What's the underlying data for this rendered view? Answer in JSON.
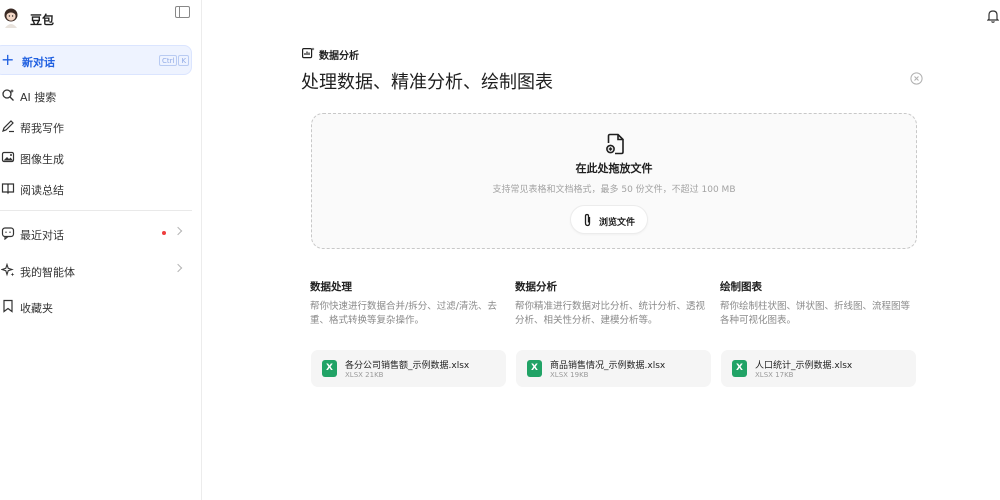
{
  "app": {
    "name": "豆包"
  },
  "sidebar": {
    "new_chat": {
      "label": "新对话",
      "shortcut": [
        "Ctrl",
        "K"
      ]
    },
    "items": [
      {
        "label": "AI 搜索",
        "icon": "ai-search-icon"
      },
      {
        "label": "帮我写作",
        "icon": "pen-icon"
      },
      {
        "label": "图像生成",
        "icon": "image-icon"
      },
      {
        "label": "阅读总结",
        "icon": "book-icon"
      }
    ],
    "recent": {
      "label": "最近对话",
      "icon": "chat-bubble-icon"
    },
    "agents": {
      "label": "我的智能体",
      "icon": "sparkle-icon"
    },
    "favorites": {
      "label": "收藏夹",
      "icon": "bookmark-icon"
    }
  },
  "main": {
    "section_label": "数据分析",
    "title": "处理数据、精准分析、绘制图表",
    "dropzone": {
      "title": "在此处拖放文件",
      "subtitle": "支持常见表格和文档格式，最多 50 份文件，不超过 100 MB",
      "browse_label": "浏览文件"
    },
    "features": [
      {
        "title": "数据处理",
        "desc": "帮你快速进行数据合并/拆分、过滤/清洗、去重、格式转换等复杂操作。"
      },
      {
        "title": "数据分析",
        "desc": "帮你精准进行数据对比分析、统计分析、透视分析、相关性分析、建模分析等。"
      },
      {
        "title": "绘制图表",
        "desc": "帮你绘制柱状图、饼状图、折线图、流程图等各种可视化图表。"
      }
    ],
    "samples": [
      {
        "name": "各分公司销售额_示例数据.xlsx",
        "meta": "XLSX 21KB",
        "badge": "X"
      },
      {
        "name": "商品销售情况_示例数据.xlsx",
        "meta": "XLSX 19KB",
        "badge": "X"
      },
      {
        "name": "人口统计_示例数据.xlsx",
        "meta": "XLSX 17KB",
        "badge": "X"
      }
    ]
  },
  "colors": {
    "accent": "#1f5fe0",
    "excel": "#21a366",
    "notification_dot": "#ee3d3d"
  }
}
